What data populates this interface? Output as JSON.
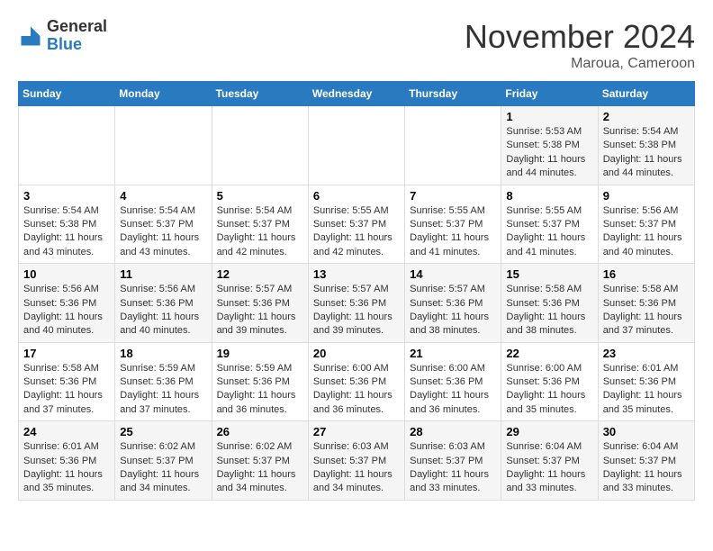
{
  "logo": {
    "general": "General",
    "blue": "Blue"
  },
  "title": "November 2024",
  "location": "Maroua, Cameroon",
  "days_of_week": [
    "Sunday",
    "Monday",
    "Tuesday",
    "Wednesday",
    "Thursday",
    "Friday",
    "Saturday"
  ],
  "weeks": [
    [
      {
        "day": "",
        "info": ""
      },
      {
        "day": "",
        "info": ""
      },
      {
        "day": "",
        "info": ""
      },
      {
        "day": "",
        "info": ""
      },
      {
        "day": "",
        "info": ""
      },
      {
        "day": "1",
        "info": "Sunrise: 5:53 AM\nSunset: 5:38 PM\nDaylight: 11 hours and 44 minutes."
      },
      {
        "day": "2",
        "info": "Sunrise: 5:54 AM\nSunset: 5:38 PM\nDaylight: 11 hours and 44 minutes."
      }
    ],
    [
      {
        "day": "3",
        "info": "Sunrise: 5:54 AM\nSunset: 5:38 PM\nDaylight: 11 hours and 43 minutes."
      },
      {
        "day": "4",
        "info": "Sunrise: 5:54 AM\nSunset: 5:37 PM\nDaylight: 11 hours and 43 minutes."
      },
      {
        "day": "5",
        "info": "Sunrise: 5:54 AM\nSunset: 5:37 PM\nDaylight: 11 hours and 42 minutes."
      },
      {
        "day": "6",
        "info": "Sunrise: 5:55 AM\nSunset: 5:37 PM\nDaylight: 11 hours and 42 minutes."
      },
      {
        "day": "7",
        "info": "Sunrise: 5:55 AM\nSunset: 5:37 PM\nDaylight: 11 hours and 41 minutes."
      },
      {
        "day": "8",
        "info": "Sunrise: 5:55 AM\nSunset: 5:37 PM\nDaylight: 11 hours and 41 minutes."
      },
      {
        "day": "9",
        "info": "Sunrise: 5:56 AM\nSunset: 5:37 PM\nDaylight: 11 hours and 40 minutes."
      }
    ],
    [
      {
        "day": "10",
        "info": "Sunrise: 5:56 AM\nSunset: 5:36 PM\nDaylight: 11 hours and 40 minutes."
      },
      {
        "day": "11",
        "info": "Sunrise: 5:56 AM\nSunset: 5:36 PM\nDaylight: 11 hours and 40 minutes."
      },
      {
        "day": "12",
        "info": "Sunrise: 5:57 AM\nSunset: 5:36 PM\nDaylight: 11 hours and 39 minutes."
      },
      {
        "day": "13",
        "info": "Sunrise: 5:57 AM\nSunset: 5:36 PM\nDaylight: 11 hours and 39 minutes."
      },
      {
        "day": "14",
        "info": "Sunrise: 5:57 AM\nSunset: 5:36 PM\nDaylight: 11 hours and 38 minutes."
      },
      {
        "day": "15",
        "info": "Sunrise: 5:58 AM\nSunset: 5:36 PM\nDaylight: 11 hours and 38 minutes."
      },
      {
        "day": "16",
        "info": "Sunrise: 5:58 AM\nSunset: 5:36 PM\nDaylight: 11 hours and 37 minutes."
      }
    ],
    [
      {
        "day": "17",
        "info": "Sunrise: 5:58 AM\nSunset: 5:36 PM\nDaylight: 11 hours and 37 minutes."
      },
      {
        "day": "18",
        "info": "Sunrise: 5:59 AM\nSunset: 5:36 PM\nDaylight: 11 hours and 37 minutes."
      },
      {
        "day": "19",
        "info": "Sunrise: 5:59 AM\nSunset: 5:36 PM\nDaylight: 11 hours and 36 minutes."
      },
      {
        "day": "20",
        "info": "Sunrise: 6:00 AM\nSunset: 5:36 PM\nDaylight: 11 hours and 36 minutes."
      },
      {
        "day": "21",
        "info": "Sunrise: 6:00 AM\nSunset: 5:36 PM\nDaylight: 11 hours and 36 minutes."
      },
      {
        "day": "22",
        "info": "Sunrise: 6:00 AM\nSunset: 5:36 PM\nDaylight: 11 hours and 35 minutes."
      },
      {
        "day": "23",
        "info": "Sunrise: 6:01 AM\nSunset: 5:36 PM\nDaylight: 11 hours and 35 minutes."
      }
    ],
    [
      {
        "day": "24",
        "info": "Sunrise: 6:01 AM\nSunset: 5:36 PM\nDaylight: 11 hours and 35 minutes."
      },
      {
        "day": "25",
        "info": "Sunrise: 6:02 AM\nSunset: 5:37 PM\nDaylight: 11 hours and 34 minutes."
      },
      {
        "day": "26",
        "info": "Sunrise: 6:02 AM\nSunset: 5:37 PM\nDaylight: 11 hours and 34 minutes."
      },
      {
        "day": "27",
        "info": "Sunrise: 6:03 AM\nSunset: 5:37 PM\nDaylight: 11 hours and 34 minutes."
      },
      {
        "day": "28",
        "info": "Sunrise: 6:03 AM\nSunset: 5:37 PM\nDaylight: 11 hours and 33 minutes."
      },
      {
        "day": "29",
        "info": "Sunrise: 6:04 AM\nSunset: 5:37 PM\nDaylight: 11 hours and 33 minutes."
      },
      {
        "day": "30",
        "info": "Sunrise: 6:04 AM\nSunset: 5:37 PM\nDaylight: 11 hours and 33 minutes."
      }
    ]
  ]
}
